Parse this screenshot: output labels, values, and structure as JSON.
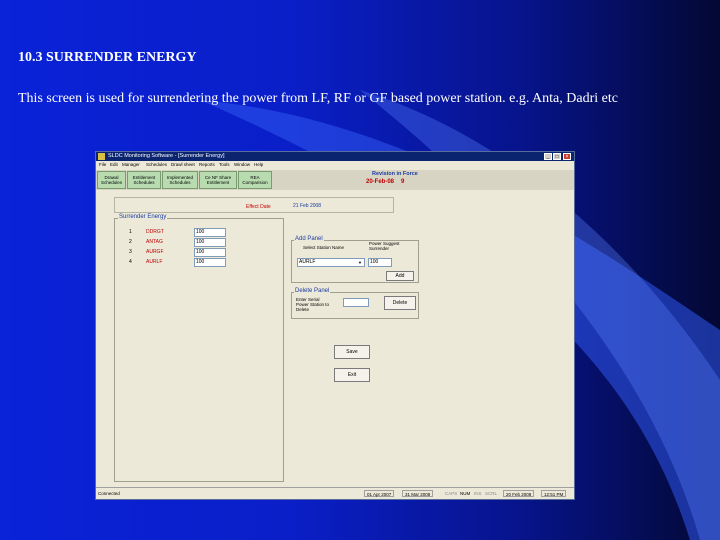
{
  "slide": {
    "title": "10.3 SURRENDER ENERGY",
    "body": "This screen is used for surrendering the power from LF, RF or GF based power station. e.g. Anta, Dadri etc"
  },
  "window": {
    "title": "SLDC Monitoring Software - [Surrender Energy]",
    "menu": [
      "File",
      "Edit",
      "Manager",
      "Schedules",
      "Drawl sheet",
      "Reports",
      "Tools",
      "Window",
      "Help"
    ],
    "nav_buttons": [
      {
        "label": "Drawal\nSchedules"
      },
      {
        "label": "Entitlement\nSchedules"
      },
      {
        "label": "Implemented\nSchedules"
      },
      {
        "label": "Ce NF Share\nEntitlement"
      },
      {
        "label": "REA\nComparision"
      }
    ],
    "revision_in_force_label": "Revision in Force",
    "revision_in_force_value": "20-Feb-08",
    "revision_number": "9",
    "effective_date_label": "Effect Date",
    "effective_date_value": "21 Feb 2008"
  },
  "surrender": {
    "title": "Surrender Energy",
    "rows": [
      {
        "no": "1",
        "name": "DDRGT",
        "value": "100"
      },
      {
        "no": "2",
        "name": "ANTAG",
        "value": "100"
      },
      {
        "no": "3",
        "name": "AURGF",
        "value": "100"
      },
      {
        "no": "4",
        "name": "AURLF",
        "value": "100"
      }
    ]
  },
  "add_panel": {
    "title": "Add Panel",
    "select_label": "Select Station Name",
    "select_value": "AURLF",
    "power_label": "Power Suggest\nSurrender",
    "power_value": "100",
    "add_button": "Add"
  },
  "delete_panel": {
    "title": "Delete Panel",
    "label": "Enter Serial\nPower Station to\nDelete",
    "value": "",
    "delete_button": "Delete"
  },
  "actions": {
    "save": "Save",
    "exit": "Exit"
  },
  "statusbar": {
    "left": "Connected",
    "date1": "01 Apr 2007",
    "date2": "31 Mar 2008",
    "caps": "CAPS",
    "num": "NUM",
    "ins": "INS",
    "scrl": "SCRL",
    "date3": "20 Feb 2008",
    "time": "12:51 PM"
  },
  "colors": {
    "slide_blue": "#0a22d8",
    "title_bar": "#0a2470",
    "accent_red": "#c00000",
    "accent_blue": "#1a3aa0",
    "nav_green": "#b8dcb0"
  }
}
